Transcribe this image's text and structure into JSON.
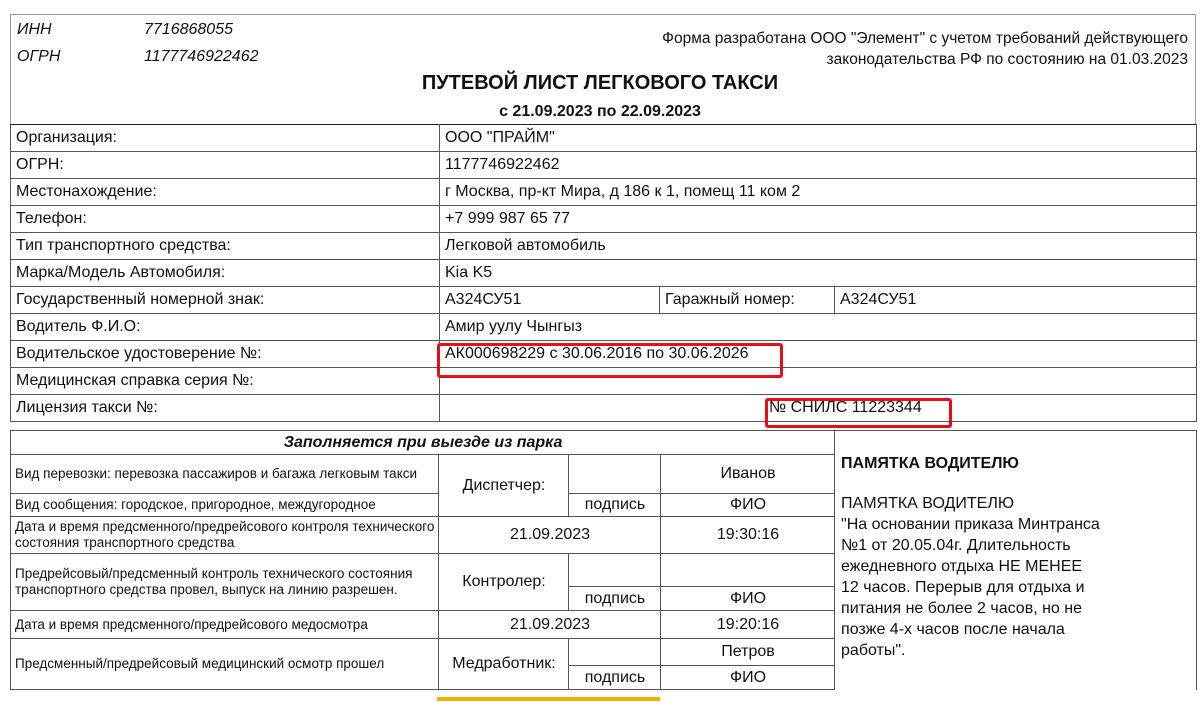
{
  "header": {
    "inn_label": "ИНН",
    "inn_value": "7716868055",
    "ogrn_label": "ОГРН",
    "ogrn_value": "1177746922462",
    "note_line1": "Форма разработана ООО \"Элемент\" с учетом требований действующего",
    "note_line2": "законодательства РФ по состоянию на 01.03.2023",
    "title": "ПУТЕВОЙ ЛИСТ ЛЕГКОВОГО ТАКСИ",
    "period": "с 21.09.2023 по 22.09.2023"
  },
  "rows": {
    "org_label": "Организация:",
    "org_value": "ООО \"ПРАЙМ\"",
    "ogrn_label": "ОГРН:",
    "ogrn_value": "1177746922462",
    "addr_label": "Местонахождение:",
    "addr_value": "г Москва, пр-кт Мира, д 186 к 1, помещ 11 ком 2",
    "phone_label": "Телефон:",
    "phone_value": "+7 999 987 65 77",
    "vtype_label": "Тип транспортного средства:",
    "vtype_value": "Легковой автомобиль",
    "model_label": "Марка/Модель Автомобиля:",
    "model_value": "Kia K5",
    "plate_label": "Государственный номерной знак:",
    "plate_value": "А324СУ51",
    "garage_label": "Гаражный номер:",
    "garage_value": "А324СУ51",
    "driver_label": "Водитель Ф.И.О:",
    "driver_value": "Амир уулу Чынгыз",
    "license_label": "Водительское удостоверение №:",
    "license_value": "АК000698229 с 30.06.2016 по 30.06.2026",
    "med_label": "Медицинская справка серия №:",
    "taxi_label": "Лицензия такси №:",
    "snils_value": "№ СНИЛС 11223344"
  },
  "lower": {
    "section_title": "Заполняется при выезде из парка",
    "transport_kind": "Вид перевозки: перевозка пассажиров и багажа легковым такси",
    "message_kind": "Вид сообщения: городское, пригородное, междугородное",
    "dispatcher_label": "Диспетчер:",
    "dispatcher_name": "Иванов",
    "sign_label": "подпись",
    "fio_label": "ФИО",
    "tech_control_label": "Дата и время предсменного/предрейсового контроля технического состояния транспортного средства",
    "tech_date": "21.09.2023",
    "tech_time": "19:30:16",
    "tech_done_label": "Предрейсовый/предсменный контроль технического состояния транспортного средства провел, выпуск на линию разрешен.",
    "controller_label": "Контролер:",
    "med_check_label": "Дата и время предсменного/предрейсового медосмотра",
    "med_date": "21.09.2023",
    "med_time": "19:20:16",
    "med_done_label": "Предсменный/предрейсовый медицинский осмотр прошел",
    "medworker_label": "Медработник:",
    "medworker_name": "Петров",
    "memo_title": "ПАМЯТКА ВОДИТЕЛЮ",
    "memo_text": "ПАМЯТКА ВОДИТЕЛЮ\n\"На основании приказа Минтранса\n№1 от 20.05.04г. Длительность\nежедневного отдыха НЕ МЕНЕЕ\n12 часов. Перерыв для отдыха и\nпитания не более 2 часов, но не\nпозже 4-х часов после начала\nработы\"."
  },
  "colors": {
    "highlight": "#e3101a",
    "underline": "#f2b300",
    "border": "#555555"
  }
}
